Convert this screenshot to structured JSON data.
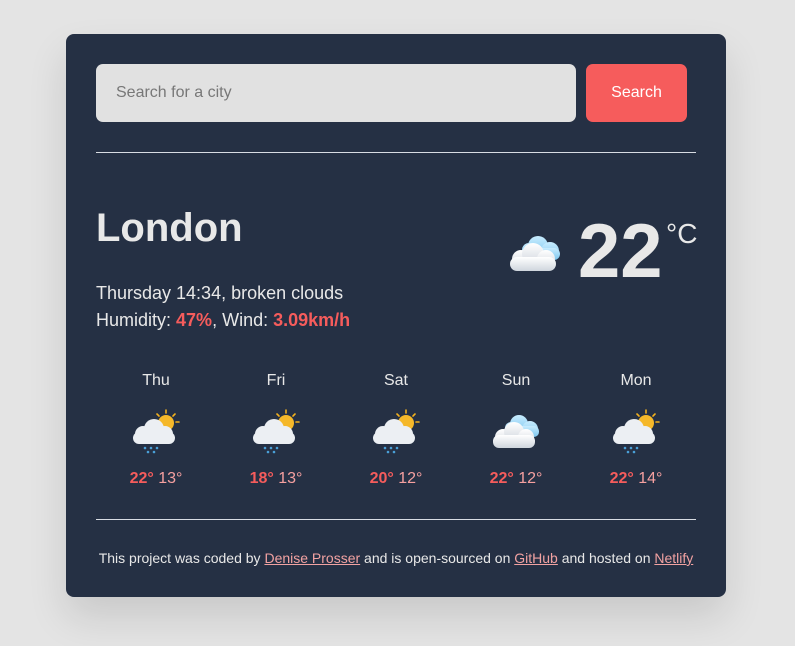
{
  "search": {
    "placeholder": "Search for a city",
    "button_label": "Search"
  },
  "current": {
    "city": "London",
    "day_time": "Thursday 14:34",
    "description": "broken clouds",
    "humidity_label": "Humidity:",
    "humidity": "47%",
    "wind_label": "Wind:",
    "wind": "3.09km/h",
    "temperature": "22",
    "unit": "°C",
    "icon": "cloudy-icon"
  },
  "forecast": [
    {
      "day": "Thu",
      "max": "22°",
      "min": "13°",
      "icon": "sun-rain-cloud-icon"
    },
    {
      "day": "Fri",
      "max": "18°",
      "min": "13°",
      "icon": "sun-rain-cloud-icon"
    },
    {
      "day": "Sat",
      "max": "20°",
      "min": "12°",
      "icon": "sun-rain-cloud-icon"
    },
    {
      "day": "Sun",
      "max": "22°",
      "min": "12°",
      "icon": "cloudy-icon"
    },
    {
      "day": "Mon",
      "max": "22°",
      "min": "14°",
      "icon": "sun-rain-cloud-icon"
    }
  ],
  "footer": {
    "text_1": "This project was coded by",
    "author": "Denise Prosser",
    "text_2": "and is open-sourced on",
    "github": "GitHub",
    "text_3": "and hosted on",
    "netlify": "Netlify"
  },
  "colors": {
    "background": "#e4e4e4",
    "card": "#253044",
    "accent": "#f65c5c",
    "text": "#e8e8e8",
    "input_bg": "#e1e1e1"
  }
}
